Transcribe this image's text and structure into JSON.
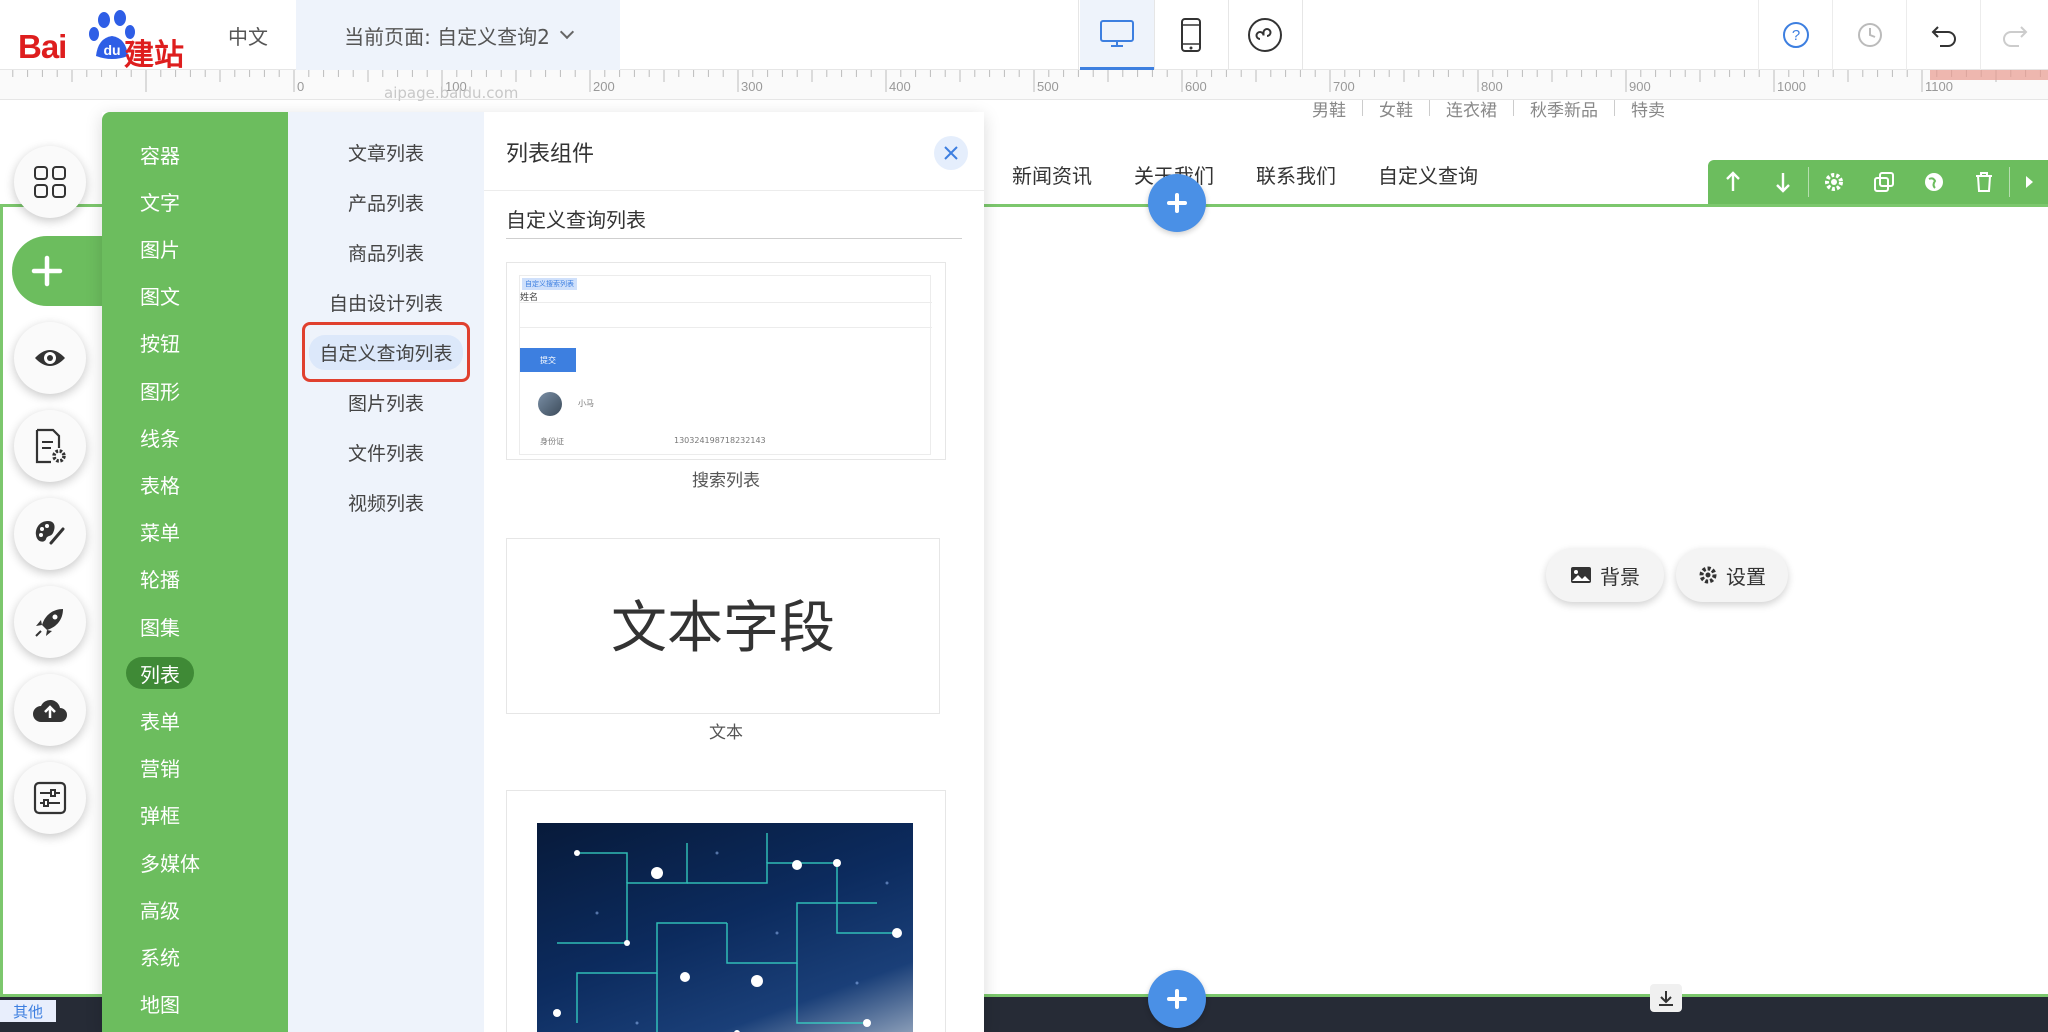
{
  "topbar": {
    "logo_text": "Bai",
    "logo_du": "du",
    "logo_cn": "建站",
    "language": "中文",
    "current_page": "当前页面: 自定义查询2"
  },
  "ruler": {
    "labels": [
      "0",
      "100",
      "200",
      "300",
      "400",
      "500",
      "600",
      "700",
      "800",
      "900",
      "1000",
      "1100"
    ],
    "watermark": "aipage.baidu.com"
  },
  "canvas": {
    "sub_nav": [
      "男鞋",
      "女鞋",
      "连衣裙",
      "秋季新品",
      "特卖"
    ],
    "main_nav": [
      "新闻资讯",
      "关于我们",
      "联系我们",
      "自定义查询"
    ],
    "background_button": "背景",
    "settings_button": "设置",
    "other_tag": "其他",
    "accent_color": "#6cbd5e",
    "primary_color": "#4a90e6"
  },
  "categories": [
    {
      "label": "容器",
      "active": false
    },
    {
      "label": "文字",
      "active": false
    },
    {
      "label": "图片",
      "active": false
    },
    {
      "label": "图文",
      "active": false
    },
    {
      "label": "按钮",
      "active": false
    },
    {
      "label": "图形",
      "active": false
    },
    {
      "label": "线条",
      "active": false
    },
    {
      "label": "表格",
      "active": false
    },
    {
      "label": "菜单",
      "active": false
    },
    {
      "label": "轮播",
      "active": false
    },
    {
      "label": "图集",
      "active": false
    },
    {
      "label": "列表",
      "active": true
    },
    {
      "label": "表单",
      "active": false
    },
    {
      "label": "营销",
      "active": false
    },
    {
      "label": "弹框",
      "active": false
    },
    {
      "label": "多媒体",
      "active": false
    },
    {
      "label": "高级",
      "active": false
    },
    {
      "label": "系统",
      "active": false
    },
    {
      "label": "地图",
      "active": false
    }
  ],
  "subcategories": [
    {
      "label": "文章列表",
      "active": false
    },
    {
      "label": "产品列表",
      "active": false
    },
    {
      "label": "商品列表",
      "active": false
    },
    {
      "label": "自由设计列表",
      "active": false
    },
    {
      "label": "自定义查询列表",
      "active": true
    },
    {
      "label": "图片列表",
      "active": false
    },
    {
      "label": "文件列表",
      "active": false
    },
    {
      "label": "视频列表",
      "active": false
    }
  ],
  "panel": {
    "title": "列表组件",
    "section": "自定义查询列表",
    "cards": [
      {
        "caption": "搜索列表",
        "preview": {
          "title": "自定义搜索列表",
          "field_label": "姓名",
          "submit": "提交",
          "user_name": "小马",
          "id_label": "身份证",
          "id_value": "130324198718232143"
        }
      },
      {
        "caption": "文本",
        "preview": {
          "big_text": "文本字段"
        }
      },
      {
        "caption": "",
        "preview": {
          "image": "tech-network-image"
        }
      }
    ]
  },
  "side_icons": [
    "grid-icon",
    "add-icon",
    "eye-icon",
    "page-settings-icon",
    "palette-icon",
    "rocket-icon",
    "cloud-upload-icon",
    "sliders-icon"
  ]
}
